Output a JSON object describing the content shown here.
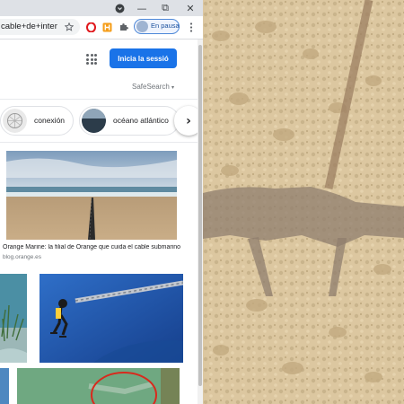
{
  "window": {
    "controls": {
      "minimize": "—",
      "maximize": "⧉",
      "close": "✕"
    }
  },
  "toolbar": {
    "url_text": "cable+de+inter",
    "profile_status": "En pausa",
    "icons": [
      "star-icon",
      "opera-icon",
      "h-extension-icon",
      "puzzle-icon",
      "more-icon"
    ]
  },
  "header": {
    "signin_label": "Inicia la sessió",
    "safesearch_label": "SafeSearch"
  },
  "chips": [
    {
      "label": "conexión"
    },
    {
      "label": "océano atlántico"
    }
  ],
  "results": [
    {
      "caption": "Orange Marine: la filial de Orange que cuida el cable submarino",
      "source": "blog.orange.es"
    }
  ],
  "colors": {
    "signin_bg": "#1a73e8",
    "titlebar_bg": "#dee1e6",
    "sand": "#d9c39b"
  }
}
